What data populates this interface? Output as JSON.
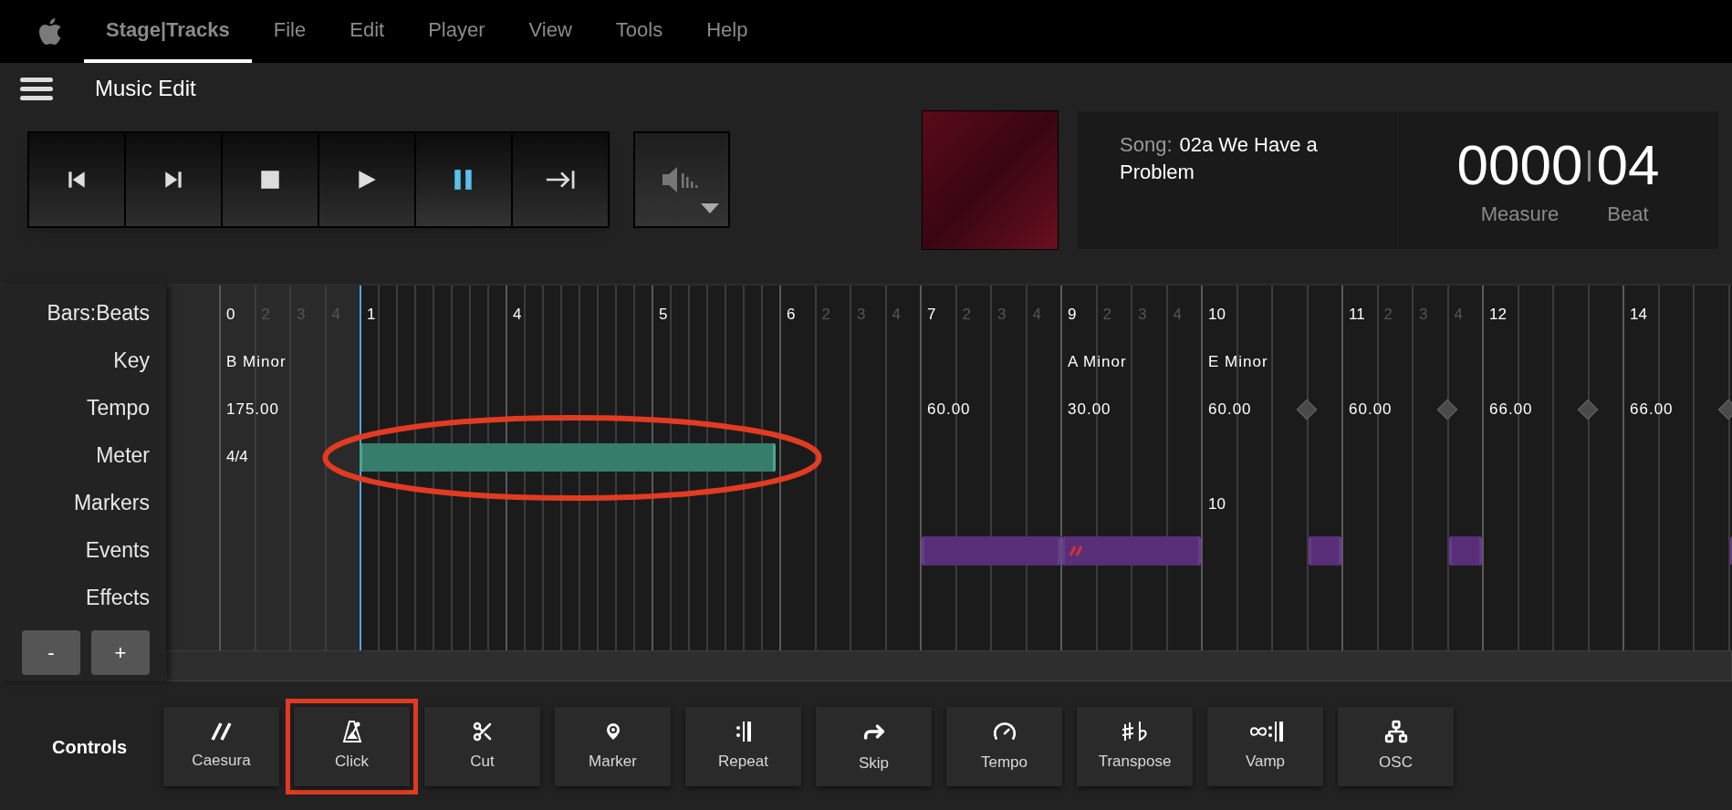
{
  "menu_bar": {
    "items": [
      {
        "label": "Stage|Tracks",
        "selected": true
      },
      {
        "label": "File",
        "selected": false
      },
      {
        "label": "Edit",
        "selected": false
      },
      {
        "label": "Player",
        "selected": false
      },
      {
        "label": "View",
        "selected": false
      },
      {
        "label": "Tools",
        "selected": false
      },
      {
        "label": "Help",
        "selected": false
      }
    ]
  },
  "header": {
    "title": "Music Edit"
  },
  "transport": [
    {
      "kind": "previous",
      "active": false
    },
    {
      "kind": "next",
      "active": false
    },
    {
      "kind": "stop",
      "active": false
    },
    {
      "kind": "play",
      "active": false
    },
    {
      "kind": "pause",
      "active": true
    },
    {
      "kind": "jump_end",
      "active": false
    }
  ],
  "song": {
    "label": "Song:",
    "title": "02a We Have a Problem"
  },
  "position": {
    "measure": "0000",
    "measure_label": "Measure",
    "beat": "04",
    "beat_label": "Beat"
  },
  "timeline": {
    "rows": [
      "Bars:Beats",
      "Key",
      "Tempo",
      "Meter",
      "Markers",
      "Events",
      "Effects"
    ],
    "zoom_buttons": [
      "-",
      "+"
    ],
    "ticks": [
      {
        "kind": "bar",
        "label": "0",
        "key": "B Minor",
        "tempo": "175.00",
        "meter": "4/4",
        "playhead": false,
        "ramp": false
      },
      {
        "kind": "beat",
        "label": "2",
        "playhead": false,
        "ramp": false
      },
      {
        "kind": "beat",
        "label": "3",
        "playhead": false,
        "ramp": false
      },
      {
        "kind": "beat",
        "label": "4",
        "playhead": false,
        "ramp": false
      },
      {
        "kind": "sub_bar",
        "label": "1",
        "playhead": true,
        "ramp": false,
        "meter_bar": true,
        "circled": true
      },
      {
        "kind": "sub",
        "playhead": false,
        "ramp": false,
        "meter_bar": true
      },
      {
        "kind": "sub",
        "playhead": false,
        "ramp": false,
        "meter_bar": true
      },
      {
        "kind": "sub",
        "playhead": false,
        "ramp": false,
        "meter_bar": true
      },
      {
        "kind": "sub",
        "playhead": false,
        "ramp": false,
        "meter_bar": true
      },
      {
        "kind": "sub",
        "playhead": false,
        "ramp": false,
        "meter_bar": true
      },
      {
        "kind": "sub",
        "playhead": false,
        "ramp": false,
        "meter_bar": true
      },
      {
        "kind": "sub",
        "playhead": false,
        "ramp": false,
        "meter_bar": true
      },
      {
        "kind": "sub_bar",
        "label": "4",
        "playhead": false,
        "ramp": false,
        "meter_bar": true
      },
      {
        "kind": "sub",
        "playhead": false,
        "ramp": false,
        "meter_bar": true
      },
      {
        "kind": "sub",
        "playhead": false,
        "ramp": false,
        "meter_bar": true
      },
      {
        "kind": "sub",
        "playhead": false,
        "ramp": false,
        "meter_bar": true
      },
      {
        "kind": "sub",
        "playhead": false,
        "ramp": false,
        "meter_bar": true
      },
      {
        "kind": "sub",
        "playhead": false,
        "ramp": false,
        "meter_bar": true
      },
      {
        "kind": "sub",
        "playhead": false,
        "ramp": false,
        "meter_bar": true
      },
      {
        "kind": "sub",
        "playhead": false,
        "ramp": false,
        "meter_bar": true
      },
      {
        "kind": "sub_bar",
        "label": "5",
        "playhead": false,
        "ramp": false,
        "meter_bar": true
      },
      {
        "kind": "sub",
        "playhead": false,
        "ramp": false,
        "meter_bar": true
      },
      {
        "kind": "sub",
        "playhead": false,
        "ramp": false,
        "meter_bar": true
      },
      {
        "kind": "sub",
        "playhead": false,
        "ramp": false,
        "meter_bar": true
      },
      {
        "kind": "sub",
        "playhead": false,
        "ramp": false,
        "meter_bar": true
      },
      {
        "kind": "sub",
        "playhead": false,
        "ramp": false,
        "meter_bar": true
      },
      {
        "kind": "sub",
        "playhead": false,
        "ramp": false,
        "meter_bar": true
      },
      {
        "kind": "bar",
        "label": "6",
        "playhead": false,
        "ramp": false
      },
      {
        "kind": "beat",
        "label": "2",
        "playhead": false,
        "ramp": false
      },
      {
        "kind": "beat",
        "label": "3",
        "playhead": false,
        "ramp": false
      },
      {
        "kind": "beat",
        "label": "4",
        "playhead": false,
        "ramp": false
      },
      {
        "kind": "bar",
        "label": "7",
        "tempo": "60.00",
        "playhead": false,
        "ramp": false,
        "event_start": true,
        "caesura": false
      },
      {
        "kind": "beat",
        "label": "2",
        "playhead": false,
        "ramp": false,
        "event": true
      },
      {
        "kind": "beat",
        "label": "3",
        "playhead": false,
        "ramp": false,
        "event": true
      },
      {
        "kind": "beat",
        "label": "4",
        "playhead": false,
        "ramp": false,
        "event": true
      },
      {
        "kind": "bar",
        "label": "9",
        "key": "A Minor",
        "tempo": "30.00",
        "playhead": false,
        "ramp": false,
        "event_start": true,
        "caesura": true
      },
      {
        "kind": "beat",
        "label": "2",
        "playhead": false,
        "ramp": false,
        "event": true
      },
      {
        "kind": "beat",
        "label": "3",
        "playhead": false,
        "ramp": false,
        "event": true
      },
      {
        "kind": "beat",
        "label": "4",
        "playhead": false,
        "ramp": false,
        "event": true
      },
      {
        "kind": "bar",
        "label": "10",
        "key": "E Minor",
        "tempo": "60.00",
        "marker": "10",
        "playhead": false,
        "ramp": false
      },
      {
        "kind": "beat",
        "playhead": false,
        "ramp": false
      },
      {
        "kind": "beat",
        "playhead": false,
        "ramp": false
      },
      {
        "kind": "beat",
        "playhead": false,
        "ramp": true,
        "event_start": true,
        "caesura": false
      },
      {
        "kind": "bar",
        "label": "11",
        "tempo": "60.00",
        "playhead": false,
        "ramp": false
      },
      {
        "kind": "beat",
        "label": "2",
        "playhead": false,
        "ramp": false
      },
      {
        "kind": "beat",
        "label": "3",
        "playhead": false,
        "ramp": false
      },
      {
        "kind": "beat",
        "label": "4",
        "playhead": false,
        "ramp": true,
        "event_start": true,
        "caesura": false
      },
      {
        "kind": "bar",
        "label": "12",
        "tempo": "66.00",
        "playhead": false,
        "ramp": false
      },
      {
        "kind": "beat",
        "playhead": false,
        "ramp": false
      },
      {
        "kind": "beat",
        "playhead": false,
        "ramp": false
      },
      {
        "kind": "beat",
        "playhead": false,
        "ramp": true
      },
      {
        "kind": "bar",
        "label": "14",
        "tempo": "66.00",
        "playhead": false,
        "ramp": false
      },
      {
        "kind": "beat",
        "playhead": false,
        "ramp": false
      },
      {
        "kind": "beat",
        "playhead": false,
        "ramp": false
      },
      {
        "kind": "beat",
        "playhead": false,
        "ramp": true,
        "event_start": true,
        "caesura": false
      }
    ]
  },
  "controls": {
    "label": "Controls",
    "items": [
      {
        "kind": "caesura",
        "label": "Caesura",
        "highlighted": false
      },
      {
        "kind": "click",
        "label": "Click",
        "highlighted": true
      },
      {
        "kind": "cut",
        "label": "Cut",
        "highlighted": false
      },
      {
        "kind": "marker",
        "label": "Marker",
        "highlighted": false
      },
      {
        "kind": "repeat",
        "label": "Repeat",
        "highlighted": false
      },
      {
        "kind": "skip",
        "label": "Skip",
        "highlighted": false
      },
      {
        "kind": "tempo",
        "label": "Tempo",
        "highlighted": false
      },
      {
        "kind": "transpose",
        "label": "Transpose",
        "highlighted": false
      },
      {
        "kind": "vamp",
        "label": "Vamp",
        "highlighted": false
      },
      {
        "kind": "osc",
        "label": "OSC",
        "highlighted": false
      }
    ]
  }
}
